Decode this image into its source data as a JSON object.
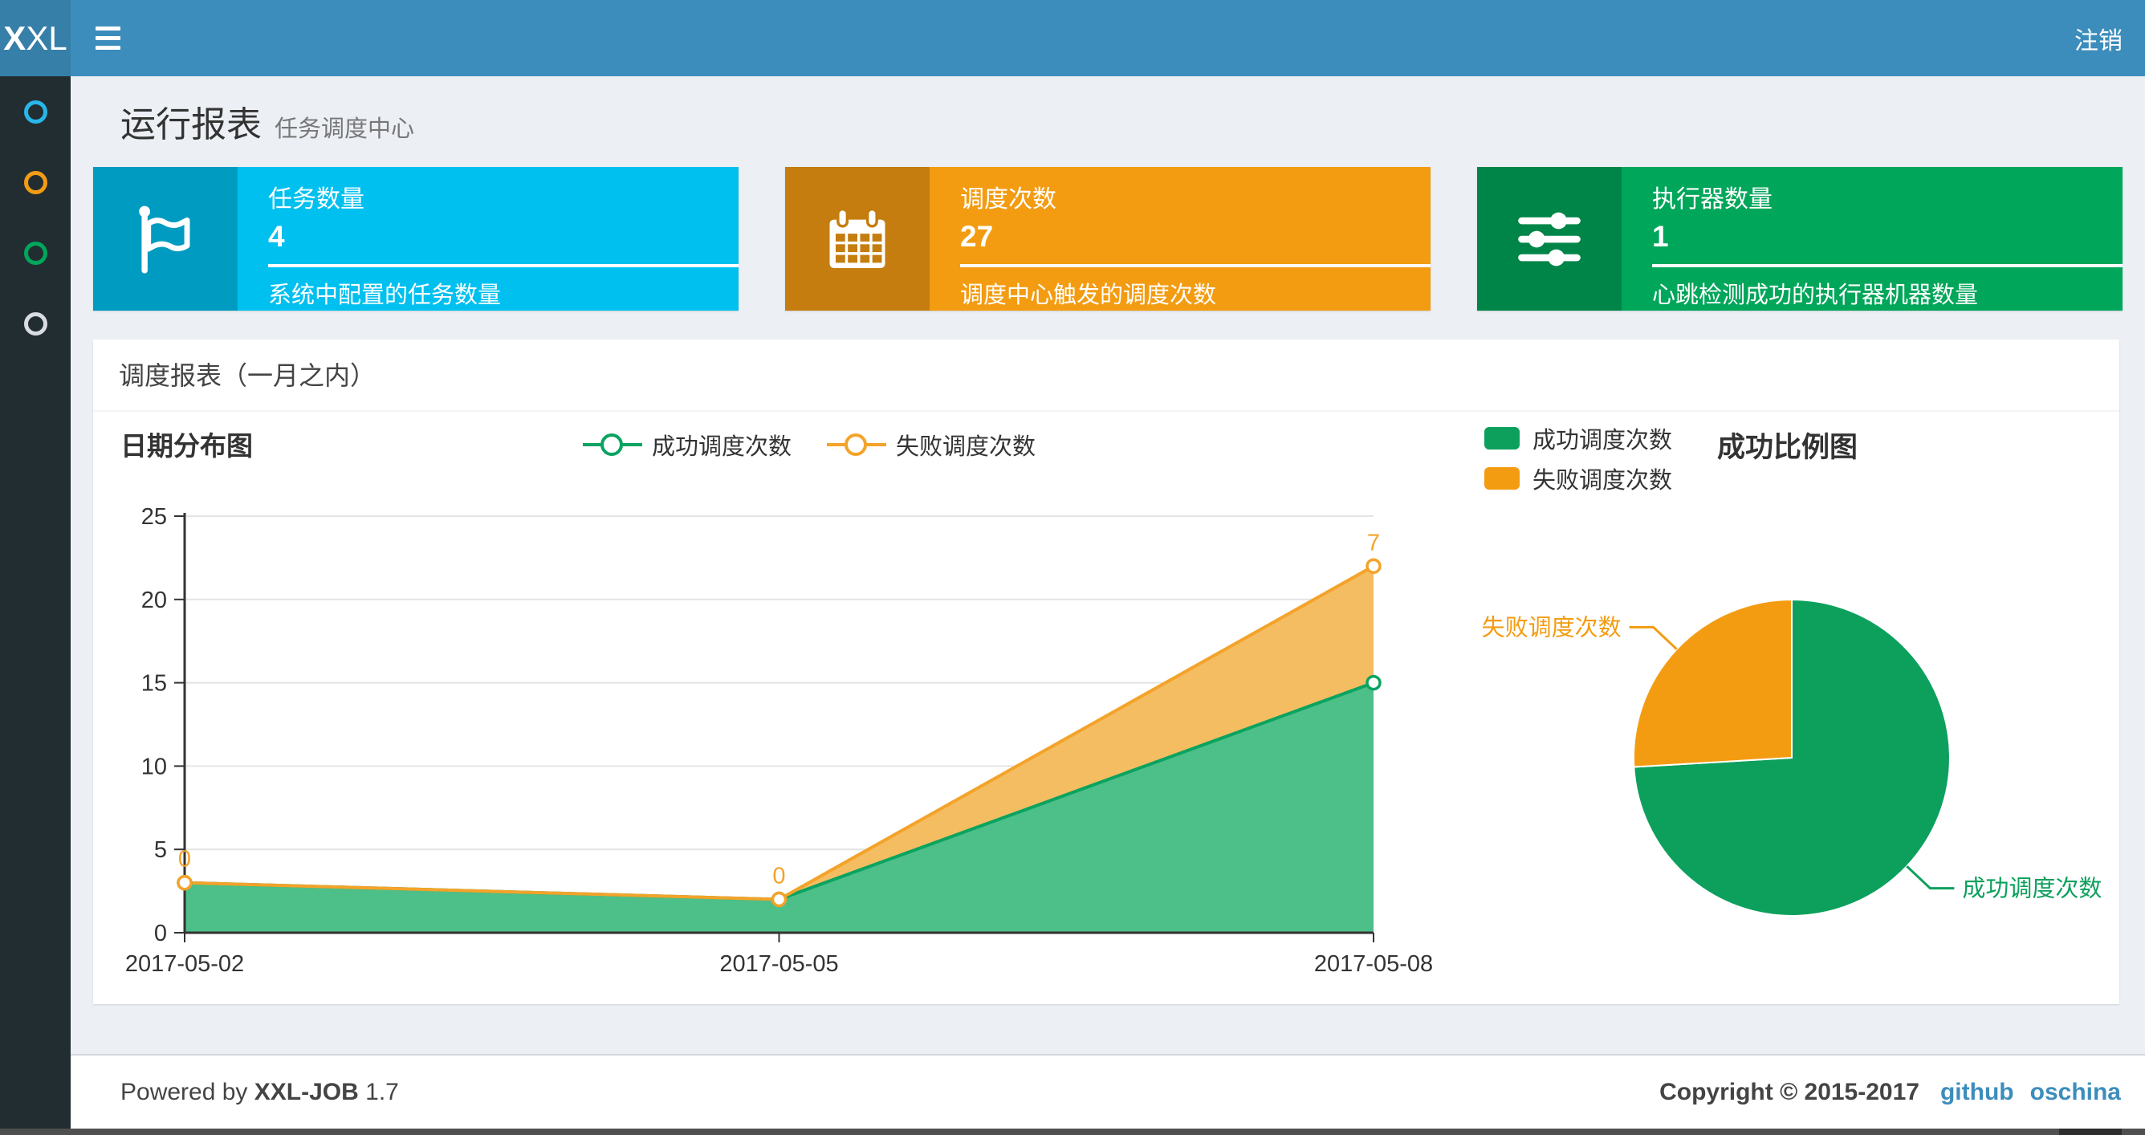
{
  "navbar": {
    "logo_bold": "X",
    "logo_rest": "XL",
    "logout_label": "注销"
  },
  "sidebar": {
    "items": [
      {
        "icon": "circle-o-icon",
        "color": "#29b6e8"
      },
      {
        "icon": "circle-o-icon",
        "color": "#f39c12"
      },
      {
        "icon": "circle-o-icon",
        "color": "#00a65a"
      },
      {
        "icon": "circle-o-icon",
        "color": "#d9dce1"
      }
    ]
  },
  "page_header": {
    "title": "运行报表",
    "subtitle": "任务调度中心"
  },
  "stat_boxes": [
    {
      "label": "任务数量",
      "value": "4",
      "description": "系统中配置的任务数量",
      "color": "#00c0ef",
      "icon_bg": "#009bc1",
      "icon": "flag-icon"
    },
    {
      "label": "调度次数",
      "value": "27",
      "description": "调度中心触发的调度次数",
      "color": "#f39c12",
      "icon_bg": "#c47d0e",
      "icon": "calendar-icon"
    },
    {
      "label": "执行器数量",
      "value": "1",
      "description": "心跳检测成功的执行器机器数量",
      "color": "#00a65a",
      "icon_bg": "#008549",
      "icon": "sliders-icon"
    }
  ],
  "panel": {
    "title": "调度报表（一月之内）"
  },
  "chart_data": [
    {
      "type": "area",
      "title": "日期分布图",
      "stacked": true,
      "x": [
        "2017-05-02",
        "2017-05-05",
        "2017-05-08"
      ],
      "series": [
        {
          "name": "成功调度次数",
          "values": [
            3,
            2,
            15
          ],
          "line_color": "#0aa360",
          "fill_color": "#4dbf88"
        },
        {
          "name": "失败调度次数",
          "values": [
            0,
            0,
            7
          ],
          "line_color": "#f3a32a",
          "fill_color": "#f5bd61"
        }
      ],
      "point_labels": {
        "series": "失败调度次数",
        "values": [
          "0",
          "0",
          "7"
        ]
      },
      "xlabel": "",
      "ylabel": "",
      "ylim": [
        0,
        25
      ],
      "yticks": [
        0,
        5,
        10,
        15,
        20,
        25
      ],
      "grid": true,
      "legend_position": "top-center"
    },
    {
      "type": "pie",
      "title": "成功比例图",
      "slices": [
        {
          "name": "成功调度次数",
          "value": 20,
          "color": "#0ca05c"
        },
        {
          "name": "失败调度次数",
          "value": 7,
          "color": "#f39c12"
        }
      ],
      "legend_position": "top-left"
    }
  ],
  "footer": {
    "powered_by": "Powered by",
    "product": "XXL-JOB",
    "version": "1.7",
    "copyright": "Copyright © 2015-2017",
    "links": [
      {
        "label": "github"
      },
      {
        "label": "oschina"
      }
    ],
    "link_color": "#3c8dbc"
  }
}
